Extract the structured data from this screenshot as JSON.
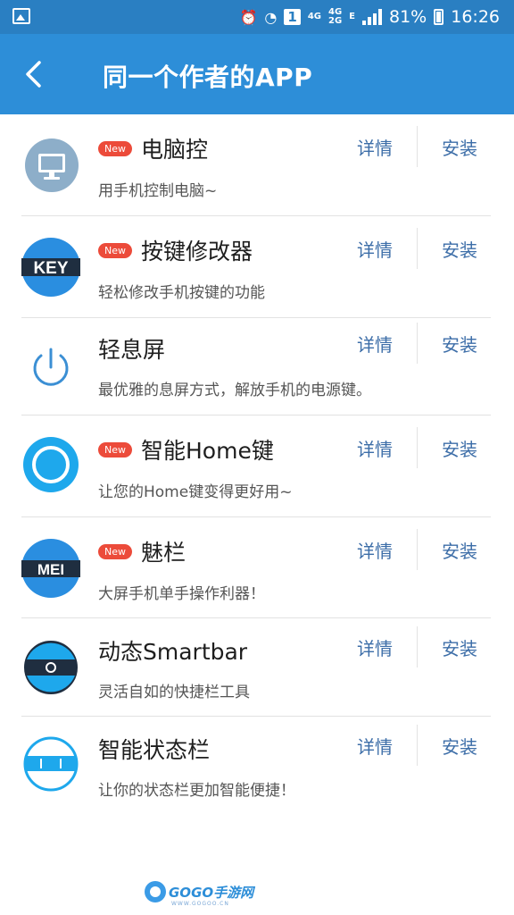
{
  "status_bar": {
    "battery": "81%",
    "time": "16:26",
    "net1": "4G",
    "net2": "4G",
    "net3": "2G",
    "e_label": "E",
    "sim": "1"
  },
  "header": {
    "title": "同一个作者的APP"
  },
  "apps": [
    {
      "name": "电脑控",
      "desc": "用手机控制电脑~",
      "new": "New",
      "detail": "详情",
      "install": "安装"
    },
    {
      "name": "按键修改器",
      "desc": "轻松修改手机按键的功能",
      "new": "New",
      "detail": "详情",
      "install": "安装",
      "icon_text": "KEY"
    },
    {
      "name": "轻息屏",
      "desc": "最优雅的息屏方式，解放手机的电源键。",
      "detail": "详情",
      "install": "安装"
    },
    {
      "name": "智能Home键",
      "desc": "让您的Home键变得更好用~",
      "new": "New",
      "detail": "详情",
      "install": "安装"
    },
    {
      "name": "魅栏",
      "desc": "大屏手机单手操作利器！",
      "new": "New",
      "detail": "详情",
      "install": "安装",
      "icon_text": "MEI"
    },
    {
      "name": "动态Smartbar",
      "desc": "灵活自如的快捷栏工具",
      "detail": "详情",
      "install": "安装"
    },
    {
      "name": "智能状态栏",
      "desc": "让你的状态栏更加智能便捷！",
      "detail": "详情",
      "install": "安装"
    }
  ],
  "watermark": {
    "brand": "GOGO手游网",
    "url": "WWW.GOGOO.CN"
  },
  "colors": {
    "status_bar": "#2a7fc2",
    "app_bar": "#2d8ed8",
    "action_text": "#3d6ea8",
    "new_badge": "#ec4b3a"
  }
}
